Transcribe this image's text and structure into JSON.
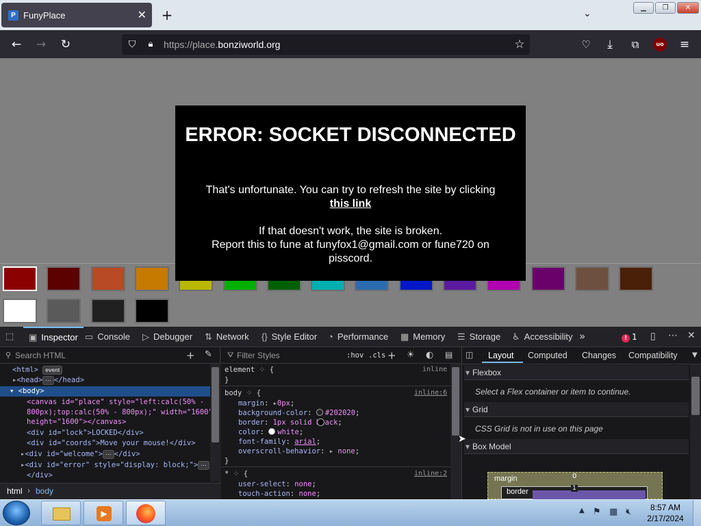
{
  "browser": {
    "tab_title": "FunyPlace",
    "tab_close": "✕",
    "new_tab": "+",
    "tab_list": "⌄",
    "url_scheme": "https://place.",
    "url_domain": "bonziworld.org",
    "ublock_label": "uo"
  },
  "page": {
    "error_title": "ERROR: SOCKET DISCONNECTED",
    "error_line1": "That's unfortunate. You can try to refresh the site by clicking",
    "error_link": "this link",
    "error_line2": "If that doesn't work, the site is broken.",
    "error_line3": "Report this to fune at funyfox1@gmail.com or fune720 on pisscord.",
    "palette_colors": [
      "#8b0000",
      "#5c0000",
      "#b84a25",
      "#c67a00",
      "#b8b800",
      "#00b000",
      "#006000",
      "#00b0b0",
      "#2a6cb0",
      "#0018c8",
      "#5a1aa0",
      "#b000b0",
      "#6a006a",
      "#6e5040",
      "#4a2008",
      "#ffffff",
      "#5a5a5a",
      "#202020",
      "#000000"
    ]
  },
  "devtools": {
    "tabs": [
      "Inspector",
      "Console",
      "Debugger",
      "Network",
      "Style Editor",
      "Performance",
      "Memory",
      "Storage",
      "Accessibility"
    ],
    "error_count": "1",
    "search_html_placeholder": "Search HTML",
    "filter_styles_placeholder": "Filter Styles",
    "hov": ":hov",
    "cls": ".cls",
    "html_lines": {
      "html": "<html>",
      "event": "event",
      "head": "<head>",
      "head_close": "</head>",
      "body": "<body>",
      "canvas1": "<canvas id=\"place\" style=\"left:calc(50% -",
      "canvas2": "800px);top:calc(50% - 800px);\" width=\"1600\"",
      "canvas3": "height=\"1600\"></canvas>",
      "lock": "<div id=\"lock\">LOCKED</div>",
      "coords": "<div id=\"coords\">Move your mouse!</div>",
      "welcome": "<div id=\"welcome\">",
      "welcome_close": "</div>",
      "error": "<div id=\"error\" style=\"display: block;\">",
      "div_close": "</div>"
    },
    "breadcrumbs": [
      "html",
      "body"
    ],
    "rules": {
      "element_selector": "element",
      "element_source": "inline",
      "body_selector": "body",
      "body_source": "inline:6",
      "star_selector": "*",
      "star_source": "inline:2",
      "decls": [
        {
          "prop": "margin",
          "value": "0px"
        },
        {
          "prop": "background-color",
          "value": "#202020"
        },
        {
          "prop": "border",
          "value": "1px solid  black"
        },
        {
          "prop": "color",
          "value": "white"
        },
        {
          "prop": "font-family",
          "value": "arial"
        },
        {
          "prop": "overscroll-behavior",
          "value": "none"
        }
      ],
      "star_decls": [
        {
          "prop": "user-select",
          "value": "none"
        },
        {
          "prop": "touch-action",
          "value": "none"
        }
      ]
    },
    "layout_tabs": [
      "Layout",
      "Computed",
      "Changes",
      "Compatibility"
    ],
    "flexbox_title": "Flexbox",
    "flexbox_msg": "Select a Flex container or item to continue.",
    "grid_title": "Grid",
    "grid_msg": "CSS Grid is not in use on this page",
    "boxmodel_title": "Box Model",
    "box_margin_label": "margin",
    "box_margin_value": "0",
    "box_border_label": "border",
    "box_border_value": "1"
  },
  "taskbar": {
    "time": "8:57 AM",
    "date": "2/17/2024"
  }
}
